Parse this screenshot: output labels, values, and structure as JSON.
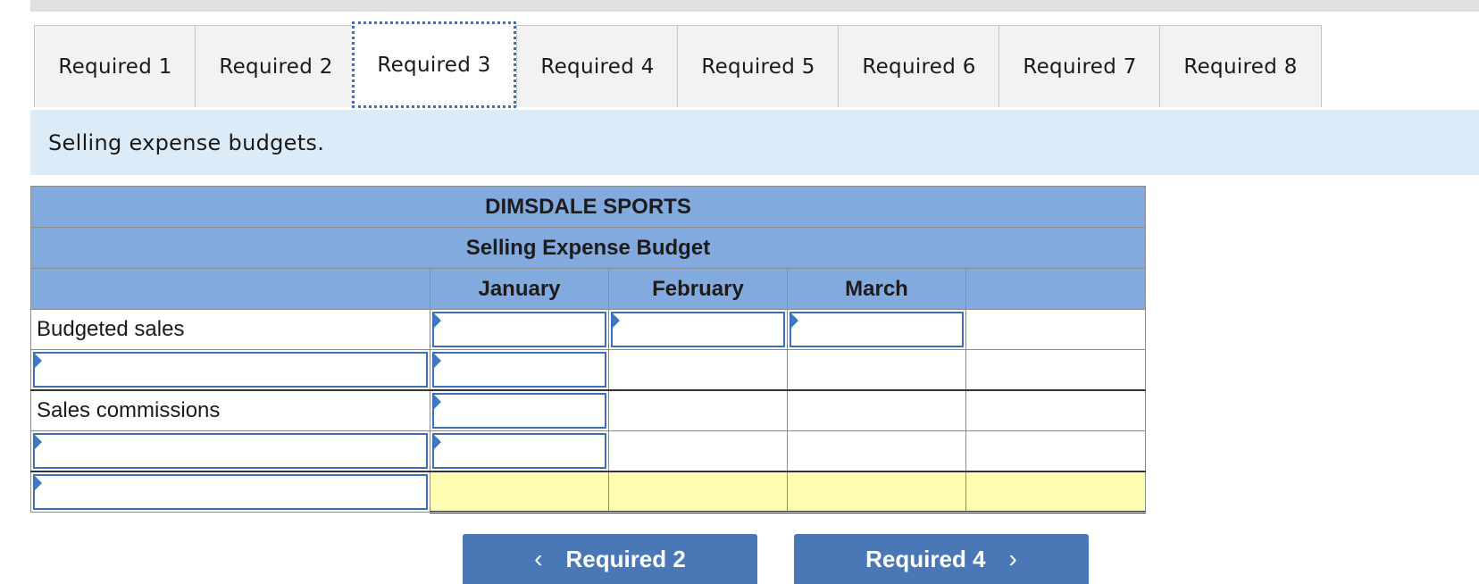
{
  "tabs": [
    {
      "label": "Required 1"
    },
    {
      "label": "Required 2"
    },
    {
      "label": "Required 3"
    },
    {
      "label": "Required 4"
    },
    {
      "label": "Required 5"
    },
    {
      "label": "Required 6"
    },
    {
      "label": "Required 7"
    },
    {
      "label": "Required 8"
    }
  ],
  "active_tab": "Required 3",
  "instruction": "Selling expense budgets.",
  "table": {
    "company": "DIMSDALE SPORTS",
    "title": "Selling Expense Budget",
    "columns": [
      "January",
      "February",
      "March",
      ""
    ],
    "rows": [
      {
        "label": "Budgeted sales",
        "values": [
          "",
          "",
          "",
          ""
        ]
      },
      {
        "label": "",
        "values": [
          "",
          "",
          "",
          ""
        ]
      },
      {
        "label": "Sales commissions",
        "values": [
          "",
          "",
          "",
          ""
        ]
      },
      {
        "label": "",
        "values": [
          "",
          "",
          "",
          ""
        ]
      },
      {
        "label": "",
        "values": [
          "",
          "",
          "",
          ""
        ]
      }
    ]
  },
  "nav": {
    "prev_label": "Required 2",
    "next_label": "Required 4",
    "prev_chevron": "‹",
    "next_chevron": "›"
  },
  "colors": {
    "header_blue": "#82aadf",
    "instruction_bg": "#dcebf8",
    "total_row_yellow": "#fffdb4",
    "button_blue": "#4a78b6"
  }
}
